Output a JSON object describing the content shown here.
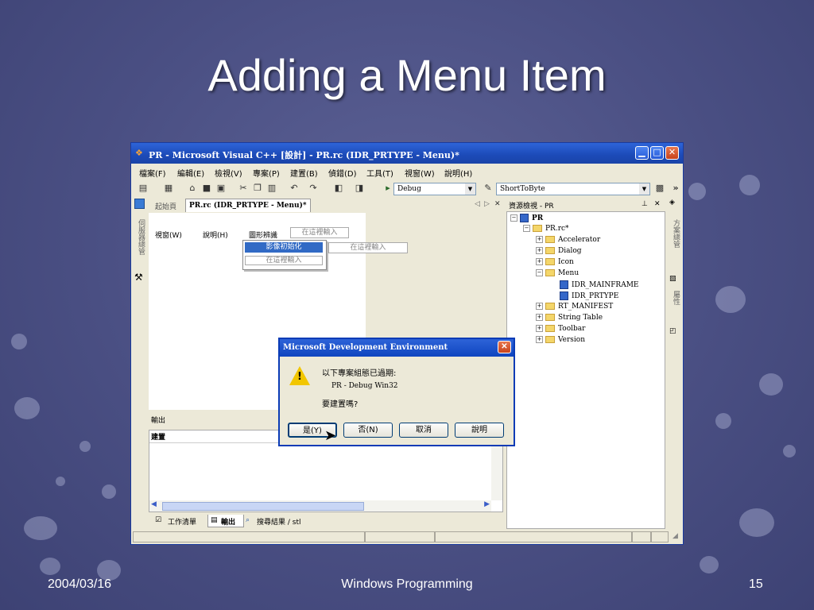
{
  "slide": {
    "title": "Adding a Menu Item",
    "footer_date": "2004/03/16",
    "footer_course": "Windows Programming",
    "footer_page": "15"
  },
  "window": {
    "title": "PR - Microsoft Visual C++ [設計] - PR.rc (IDR_PRTYPE - Menu)*",
    "menu": [
      "檔案(F)",
      "編輯(E)",
      "檢視(V)",
      "專案(P)",
      "建置(B)",
      "偵錯(D)",
      "工具(T)",
      "視窗(W)",
      "說明(H)"
    ],
    "config_combo": "Debug",
    "find_combo": "ShortToByte",
    "overflow_glyph": "»"
  },
  "editor": {
    "tab_start": "起始頁",
    "tab_active": "PR.rc (IDR_PRTYPE - Menu)*",
    "menu_items": [
      "視窗(W)",
      "說明(H)",
      "圖形辨識"
    ],
    "type_here": "在這裡輸入",
    "submenu_selected": "影像初始化",
    "side_tab_server": "伺服器總管"
  },
  "output": {
    "title": "輸出",
    "build_label": "建置",
    "bottom_tabs": [
      "工作清單",
      "輸出",
      "搜尋結果 / stl"
    ]
  },
  "resource_view": {
    "title": "資源檢視 - PR",
    "root": "PR",
    "rc_file": "PR.rc*",
    "items": [
      "Accelerator",
      "Dialog",
      "Icon",
      "Menu"
    ],
    "menu_children": [
      "IDR_MAINFRAME",
      "IDR_PRTYPE"
    ],
    "items_after": [
      "RT_MANIFEST",
      "String Table",
      "Toolbar",
      "Version"
    ],
    "side_tab_solution": "方案總管",
    "side_tab_props": "屬性"
  },
  "dialog": {
    "title": "Microsoft Development Environment",
    "line1": "以下專案組態已過期:",
    "line2": "PR - Debug Win32",
    "line3": "要建置嗎?",
    "buttons": [
      "是(Y)",
      "否(N)",
      "取消",
      "說明"
    ]
  }
}
